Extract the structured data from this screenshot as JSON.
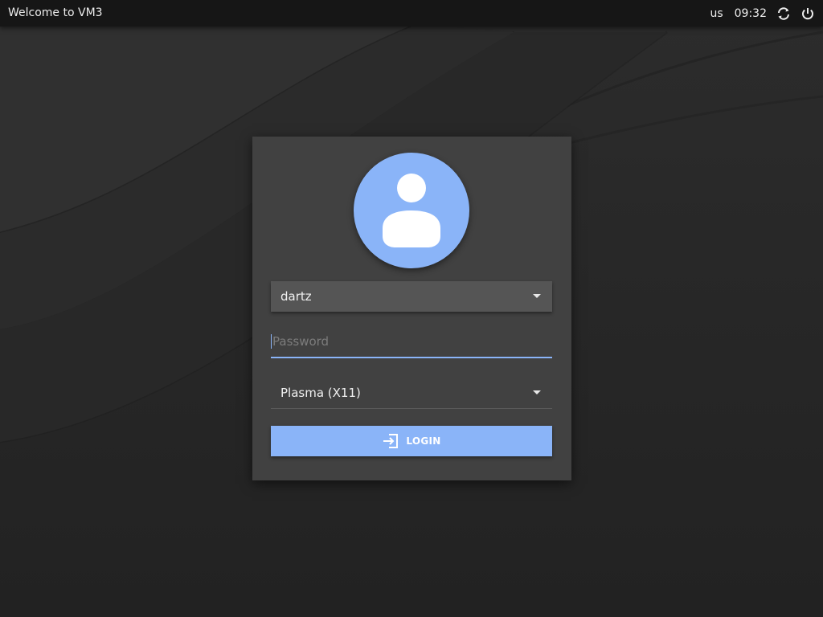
{
  "topbar": {
    "title": "Welcome to VM3",
    "keyboard_layout": "us",
    "clock": "09:32",
    "icons": [
      "refresh-icon",
      "power-icon"
    ]
  },
  "login": {
    "user": "dartz",
    "password_placeholder": "Password",
    "session": "Plasma (X11)",
    "button_label": "LOGIN",
    "avatar_icon": "user-silhouette-icon",
    "button_icon": "login-icon"
  },
  "colors": {
    "accent": "#8ab4f8",
    "background": "#262626",
    "topbar": "#161616",
    "card": "#414141"
  }
}
